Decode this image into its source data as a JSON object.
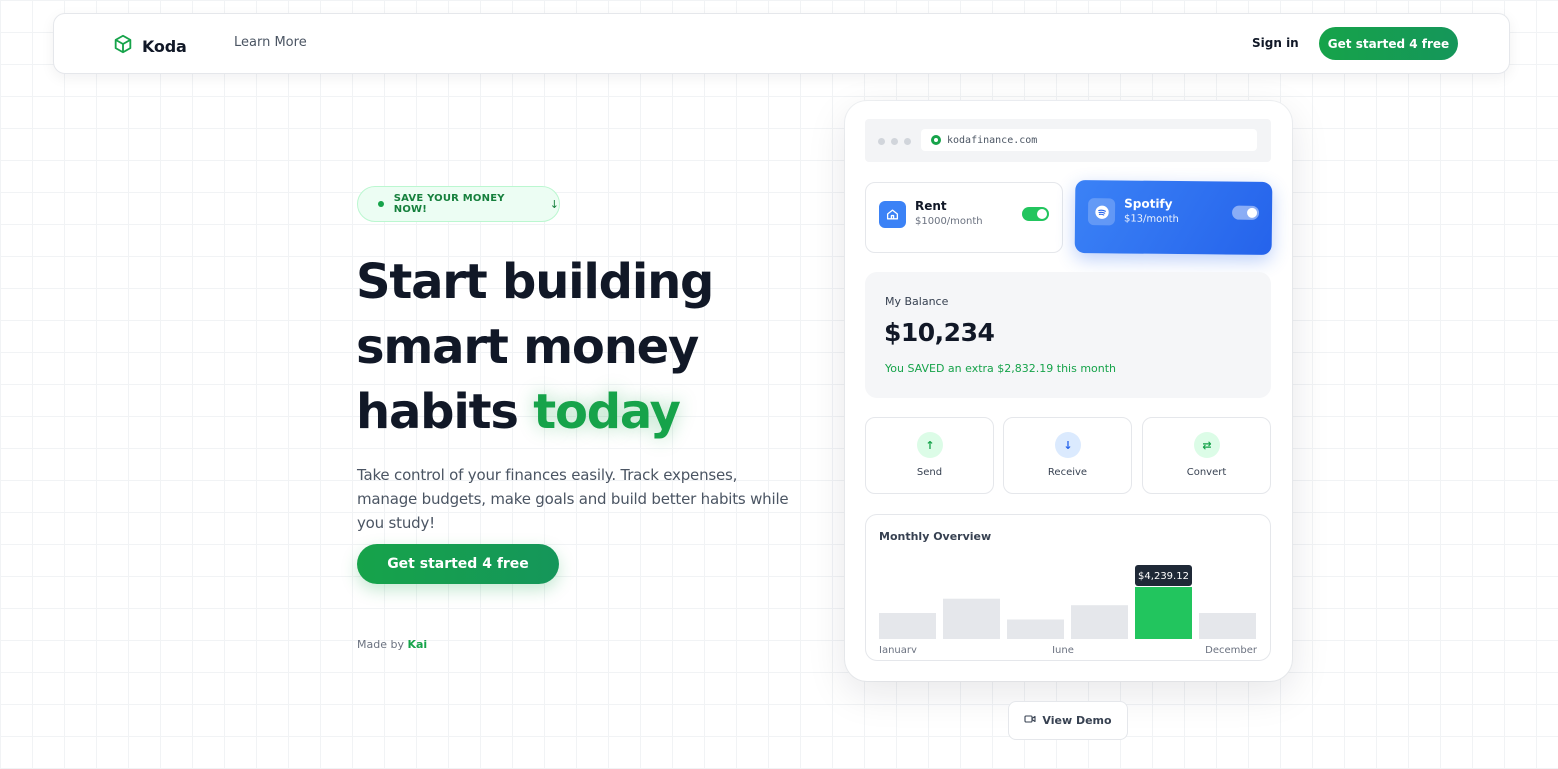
{
  "nav": {
    "brand": "Koda",
    "learn_more": "Learn More",
    "sign_in": "Sign in",
    "cta": "Get started 4 free"
  },
  "hero": {
    "pill": "SAVE YOUR MONEY NOW!",
    "headline_line1": "Start building",
    "headline_line2": "smart money",
    "headline_line3_prefix": "habits",
    "headline_accent": "today",
    "subtitle": "Take control of your finances easily. Track expenses, manage budgets, make goals and build better habits while you study!",
    "cta": "Get started 4 free",
    "made_by_prefix": "Made by",
    "made_by_name": "Kai"
  },
  "device": {
    "url": "kodafinance.com",
    "subscriptions": [
      {
        "name": "Rent",
        "price": "$1000/month",
        "enabled": true
      },
      {
        "name": "Spotify",
        "price": "$13/month",
        "enabled": true
      }
    ],
    "balance": {
      "label": "My Balance",
      "amount": "$10,234",
      "note": "You SAVED an extra $2,832.19 this month"
    },
    "actions": [
      {
        "label": "Send",
        "icon": "arrow-up-icon"
      },
      {
        "label": "Receive",
        "icon": "arrow-down-icon"
      },
      {
        "label": "Convert",
        "icon": "swap-icon"
      }
    ],
    "overview_title": "Monthly Overview",
    "view_demo": "View Demo"
  },
  "chart_data": {
    "type": "bar",
    "title": "Monthly Overview",
    "tick_labels": [
      "January",
      "June",
      "December"
    ],
    "values": [
      1.0,
      1.55,
      0.75,
      1.3,
      2.0,
      1.0
    ],
    "highlight_index": 4,
    "highlight_label": "$4,239.12"
  },
  "colors": {
    "accent": "#16a34a",
    "bar": "#e5e7eb",
    "bar_highlight": "#22c55e",
    "spotify_blue": "#2563eb"
  }
}
